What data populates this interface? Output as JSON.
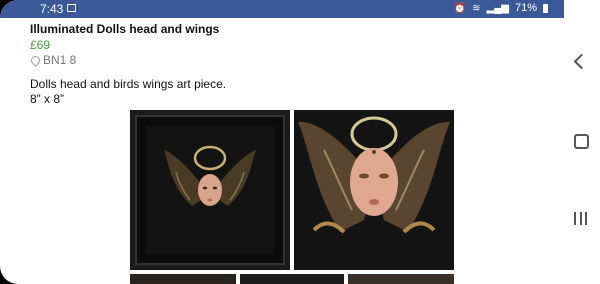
{
  "status_bar": {
    "time": "7:43",
    "battery_pct": "71%"
  },
  "listing": {
    "title": "Illuminated Dolls head and wings",
    "price": "£69",
    "location": "BN1 8",
    "description_line1": "Dolls head and birds wings art piece.",
    "description_line2": "8” x 8”"
  },
  "colors": {
    "status_bar_bg": "#3b5998",
    "price": "#43a047"
  },
  "nav_bar": {
    "icons": [
      "back-icon",
      "home-icon",
      "recent-apps-icon"
    ]
  }
}
